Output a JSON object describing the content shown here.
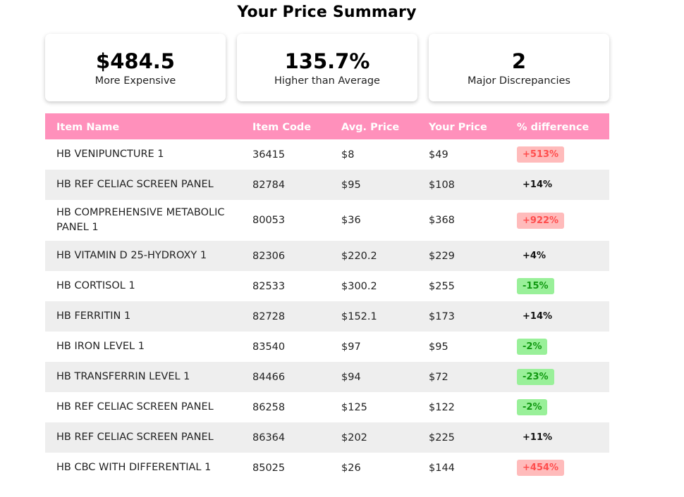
{
  "title": "Your Price Summary",
  "summary_cards": [
    {
      "value": "$484.5",
      "label": "More Expensive"
    },
    {
      "value": "135.7%",
      "label": "Higher than Average"
    },
    {
      "value": "2",
      "label": "Major Discrepancies"
    }
  ],
  "table": {
    "headers": [
      "Item Name",
      "Item Code",
      "Avg. Price",
      "Your Price",
      "% difference"
    ],
    "rows": [
      {
        "name": "HB VENIPUNCTURE 1",
        "code": "36415",
        "avg": "$8",
        "yours": "$49",
        "diff": "+513%",
        "status": "up"
      },
      {
        "name": "HB REF CELIAC SCREEN PANEL",
        "code": "82784",
        "avg": "$95",
        "yours": "$108",
        "diff": "+14%",
        "status": "neutral"
      },
      {
        "name": "HB COMPREHENSIVE METABOLIC PANEL 1",
        "code": "80053",
        "avg": "$36",
        "yours": "$368",
        "diff": "+922%",
        "status": "up"
      },
      {
        "name": "HB VITAMIN D 25-HYDROXY 1",
        "code": "82306",
        "avg": "$220.2",
        "yours": "$229",
        "diff": "+4%",
        "status": "neutral"
      },
      {
        "name": "HB CORTISOL 1",
        "code": "82533",
        "avg": "$300.2",
        "yours": "$255",
        "diff": "-15%",
        "status": "down"
      },
      {
        "name": "HB FERRITIN 1",
        "code": "82728",
        "avg": "$152.1",
        "yours": "$173",
        "diff": "+14%",
        "status": "neutral"
      },
      {
        "name": "HB IRON LEVEL 1",
        "code": "83540",
        "avg": "$97",
        "yours": "$95",
        "diff": "-2%",
        "status": "down"
      },
      {
        "name": "HB TRANSFERRIN LEVEL 1",
        "code": "84466",
        "avg": "$94",
        "yours": "$72",
        "diff": "-23%",
        "status": "down"
      },
      {
        "name": "HB REF CELIAC SCREEN PANEL",
        "code": "86258",
        "avg": "$125",
        "yours": "$122",
        "diff": "-2%",
        "status": "down"
      },
      {
        "name": "HB REF CELIAC SCREEN PANEL",
        "code": "86364",
        "avg": "$202",
        "yours": "$225",
        "diff": "+11%",
        "status": "neutral"
      },
      {
        "name": "HB CBC WITH DIFFERENTIAL 1",
        "code": "85025",
        "avg": "$26",
        "yours": "$144",
        "diff": "+454%",
        "status": "up"
      }
    ]
  },
  "colors": {
    "header_bg": "#ff90bb",
    "row_alt_bg": "#eeeeee",
    "badge_up_bg": "#ffbbbb",
    "badge_up_text": "#ff4d4d",
    "badge_down_bg": "#99f099",
    "badge_down_text": "#119911"
  }
}
